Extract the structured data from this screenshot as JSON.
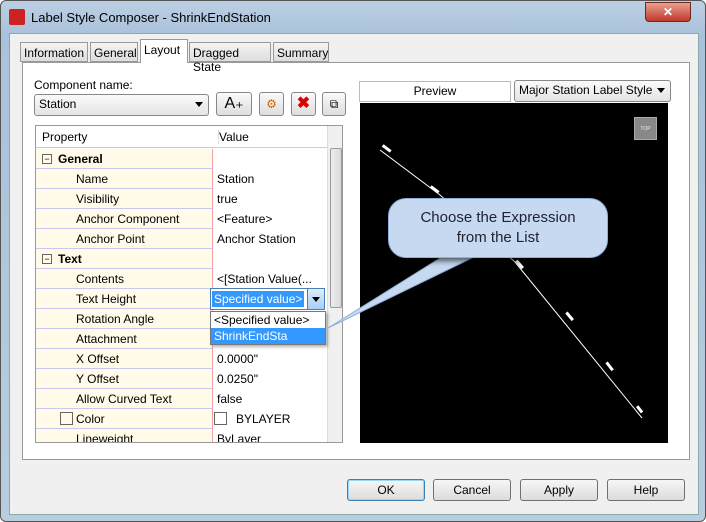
{
  "window": {
    "title": "Label Style Composer - ShrinkEndStation",
    "close": "✕"
  },
  "tabs": [
    "Information",
    "General",
    "Layout",
    "Dragged State",
    "Summary"
  ],
  "component": {
    "label": "Component name:",
    "value": "Station"
  },
  "toolbar": {
    "add": "A₊"
  },
  "grid": {
    "headers": [
      "Property",
      "Value"
    ],
    "rows": [
      {
        "p": "General",
        "v": "",
        "cat": true
      },
      {
        "p": "Name",
        "v": "Station"
      },
      {
        "p": "Visibility",
        "v": "true"
      },
      {
        "p": "Anchor Component",
        "v": "<Feature>"
      },
      {
        "p": "Anchor Point",
        "v": "Anchor Station"
      },
      {
        "p": "Text",
        "v": "",
        "cat": true
      },
      {
        "p": "Contents",
        "v": "<[Station Value(..."
      },
      {
        "p": "Text Height",
        "v": "Specified value>"
      },
      {
        "p": "Rotation Angle",
        "v": ""
      },
      {
        "p": "Attachment",
        "v": ""
      },
      {
        "p": "X Offset",
        "v": "0.0000\""
      },
      {
        "p": "Y Offset",
        "v": "0.0250\""
      },
      {
        "p": "Allow Curved Text",
        "v": "false"
      },
      {
        "p": "Color",
        "v": "BYLAYER"
      },
      {
        "p": "Lineweight",
        "v": "ByLayer"
      }
    ]
  },
  "dropdown": {
    "options": [
      "<Specified value>",
      "ShrinkEndSta"
    ],
    "selected": 1
  },
  "preview": {
    "label": "Preview",
    "style": "Major Station Label Style",
    "viewcube": "TOP"
  },
  "callout": {
    "line1": "Choose the Expression",
    "line2": "from the List"
  },
  "buttons": {
    "ok": "OK",
    "cancel": "Cancel",
    "apply": "Apply",
    "help": "Help"
  }
}
